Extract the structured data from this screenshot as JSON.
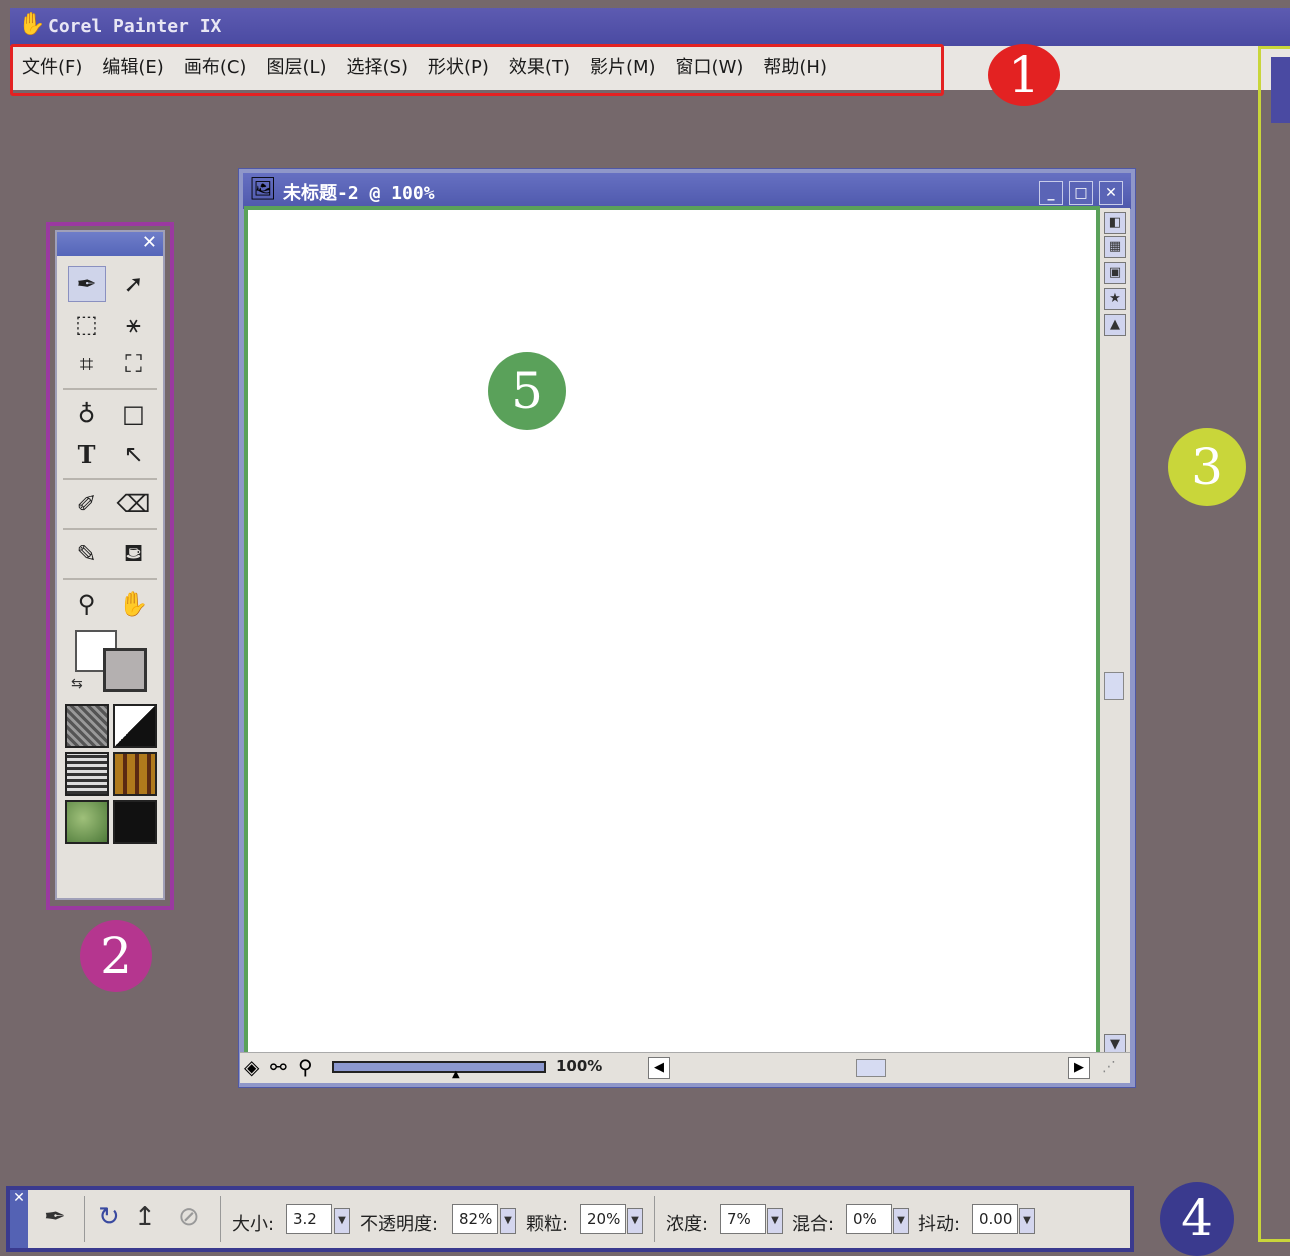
{
  "app": {
    "title": "Corel Painter IX"
  },
  "menu": {
    "items": [
      "文件(F)",
      "编辑(E)",
      "画布(C)",
      "图层(L)",
      "选择(S)",
      "形状(P)",
      "效果(T)",
      "影片(M)",
      "窗口(W)",
      "帮助(H)"
    ]
  },
  "callouts": {
    "n1": "1",
    "n2": "2",
    "n3": "3",
    "n4": "4",
    "n5": "5"
  },
  "document": {
    "title": "未标题-2 @ 100%",
    "zoom": "100%"
  },
  "property_bar": {
    "size_label": "大小:",
    "size_value": "3.2",
    "opacity_label": "不透明度:",
    "opacity_value": "82%",
    "grain_label": "颗粒:",
    "grain_value": "20%",
    "resat_label": "浓度:",
    "resat_value": "7%",
    "bleed_label": "混合:",
    "bleed_value": "0%",
    "jitter_label": "抖动:",
    "jitter_value": "0.00"
  },
  "colors": {
    "workspace": "#75686b",
    "callout_1": "#e32222",
    "callout_2": "#9a3aa0",
    "callout_3": "#c9d63a",
    "callout_4": "#3a3a8e",
    "callout_5": "#5aa15a",
    "primary_color": "#ffffff",
    "secondary_color": "#b4b0b0"
  },
  "icons": {
    "tools": [
      "brush-icon",
      "layer-adjuster-icon",
      "rect-selection-icon",
      "magic-wand-icon",
      "crop-icon",
      "selection-adjuster-icon",
      "pen-icon",
      "rectangle-shape-icon",
      "text-icon",
      "shape-selection-icon",
      "dodge-icon",
      "eraser-icon",
      "dropper-icon",
      "paint-bucket-icon",
      "magnifier-icon",
      "grabber-icon"
    ]
  }
}
